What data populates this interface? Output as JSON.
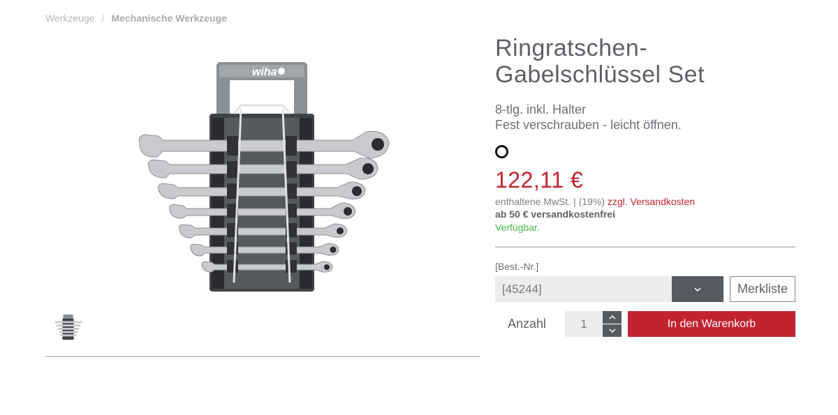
{
  "breadcrumb": {
    "items": [
      "Werkzeuge",
      "Mechanische Werkzeuge"
    ],
    "separator": "/"
  },
  "gallery": {
    "main_image": "ratcheting-wrench-set-with-holder",
    "brand_logo_text": "wiha",
    "thumbnail": "ratcheting-wrench-set-thumbnail"
  },
  "product": {
    "title_line1": "Ringratschen-",
    "title_line2": "Gabelschlüssel Set",
    "subtitle_line1": "8-tlg. inkl. Halter",
    "subtitle_line2": "Fest verschrauben - leicht öffnen.",
    "price": "122,11 €",
    "tax_text": "enthaltene MwSt. | (19%)",
    "shipping_link": "zzgl. Versandkosten",
    "free_shipping": "ab 50 € versandkostenfrei",
    "availability": "Verfügbar."
  },
  "order": {
    "label": "[Best.-Nr.]",
    "selected": "[45244]",
    "wishlist_label": "Merkliste",
    "quantity_label": "Anzahl",
    "quantity_value": "1",
    "add_to_cart_label": "In den Warenkorb"
  },
  "colors": {
    "accent_red": "#c2232f",
    "available_green": "#4cb848",
    "dark_control": "#565b62"
  }
}
